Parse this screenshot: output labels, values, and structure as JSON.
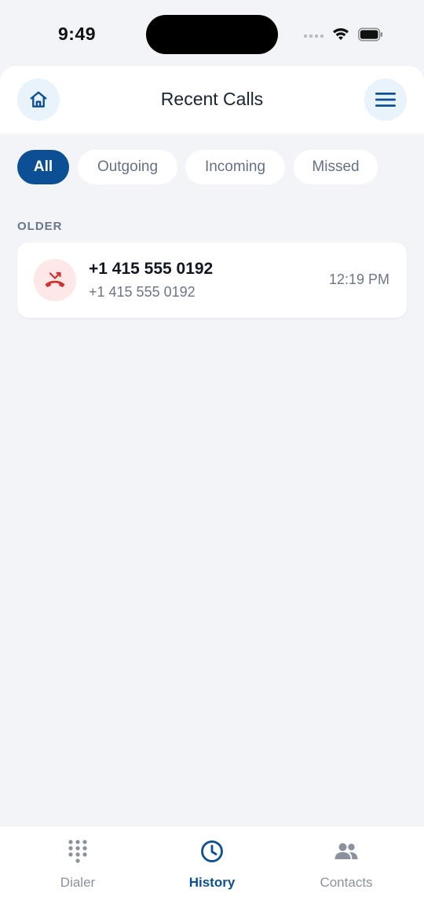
{
  "status_bar": {
    "time": "9:49"
  },
  "header": {
    "title": "Recent Calls",
    "left_icon": "home-icon",
    "right_icon": "menu-icon"
  },
  "filters": {
    "items": [
      {
        "label": "All",
        "active": true
      },
      {
        "label": "Outgoing",
        "active": false
      },
      {
        "label": "Incoming",
        "active": false
      },
      {
        "label": "Missed",
        "active": false
      }
    ]
  },
  "sections": [
    {
      "label": "OLDER",
      "calls": [
        {
          "name": "+1 415 555 0192",
          "number": "+1 415 555 0192",
          "time": "12:19 PM",
          "type": "missed",
          "icon": "missed-call-icon"
        }
      ]
    }
  ],
  "bottom_nav": {
    "items": [
      {
        "label": "Dialer",
        "icon": "dialpad-icon",
        "active": false
      },
      {
        "label": "History",
        "icon": "clock-icon",
        "active": true
      },
      {
        "label": "Contacts",
        "icon": "people-icon",
        "active": false
      }
    ]
  },
  "colors": {
    "accent": "#0d4f95",
    "background": "#f2f4f8",
    "missed": "#d32f2f",
    "missed_bg": "#fde7e7",
    "muted_text": "#6b7687"
  }
}
